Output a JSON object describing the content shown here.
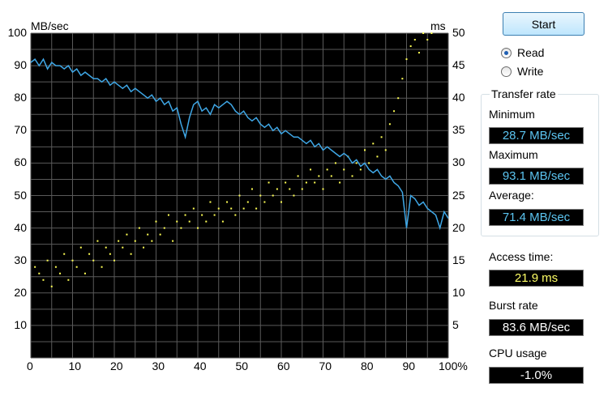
{
  "chart": {
    "y_unit_left": "MB/sec",
    "y_unit_right": "ms",
    "left_ticks": [
      "100",
      "90",
      "80",
      "70",
      "60",
      "50",
      "40",
      "30",
      "20",
      "10"
    ],
    "right_ticks": [
      "50",
      "45",
      "40",
      "35",
      "30",
      "25",
      "20",
      "15",
      "10",
      "5"
    ],
    "x_ticks": [
      "0",
      "10",
      "20",
      "30",
      "40",
      "50",
      "60",
      "70",
      "80",
      "90",
      "100%"
    ],
    "colors": {
      "background": "#000000",
      "grid": "#5a5a5a",
      "transfer_line": "#3fa7e6",
      "access_points": "#ffff55"
    }
  },
  "chart_data": {
    "type": "line",
    "x": [
      0,
      1,
      2,
      3,
      4,
      5,
      6,
      7,
      8,
      9,
      10,
      11,
      12,
      13,
      14,
      15,
      16,
      17,
      18,
      19,
      20,
      21,
      22,
      23,
      24,
      25,
      26,
      27,
      28,
      29,
      30,
      31,
      32,
      33,
      34,
      35,
      36,
      37,
      38,
      39,
      40,
      41,
      42,
      43,
      44,
      45,
      46,
      47,
      48,
      49,
      50,
      51,
      52,
      53,
      54,
      55,
      56,
      57,
      58,
      59,
      60,
      61,
      62,
      63,
      64,
      65,
      66,
      67,
      68,
      69,
      70,
      71,
      72,
      73,
      74,
      75,
      76,
      77,
      78,
      79,
      80,
      81,
      82,
      83,
      84,
      85,
      86,
      87,
      88,
      89,
      90,
      91,
      92,
      93,
      94,
      95,
      96,
      97,
      98,
      99,
      100
    ],
    "series": [
      {
        "values": [
          91,
          92,
          90,
          92,
          89,
          91,
          90,
          90,
          89,
          90,
          88,
          89,
          87,
          88,
          87,
          86,
          86,
          85,
          86,
          84,
          85,
          84,
          83,
          84,
          82,
          83,
          82,
          81,
          80,
          81,
          79,
          80,
          78,
          79,
          76,
          77,
          72,
          68,
          74,
          78,
          79,
          76,
          77,
          75,
          78,
          77,
          78,
          79,
          78,
          76,
          75,
          76,
          74,
          73,
          74,
          72,
          71,
          72,
          70,
          71,
          69,
          70,
          69,
          68,
          68,
          67,
          66,
          67,
          65,
          66,
          64,
          65,
          64,
          63,
          62,
          63,
          62,
          60,
          61,
          59,
          60,
          58,
          57,
          58,
          56,
          55,
          56,
          54,
          53,
          51,
          40,
          50,
          49,
          47,
          48,
          46,
          45,
          44,
          40,
          45,
          43
        ]
      }
    ],
    "access_time_ms": [
      [
        1,
        14
      ],
      [
        2,
        13
      ],
      [
        3,
        12
      ],
      [
        4,
        15
      ],
      [
        5,
        11
      ],
      [
        6,
        14
      ],
      [
        7,
        13
      ],
      [
        8,
        16
      ],
      [
        9,
        12
      ],
      [
        10,
        15
      ],
      [
        11,
        14
      ],
      [
        12,
        17
      ],
      [
        13,
        13
      ],
      [
        14,
        16
      ],
      [
        15,
        15
      ],
      [
        16,
        18
      ],
      [
        17,
        14
      ],
      [
        18,
        17
      ],
      [
        19,
        16
      ],
      [
        20,
        15
      ],
      [
        21,
        18
      ],
      [
        22,
        17
      ],
      [
        23,
        19
      ],
      [
        24,
        16
      ],
      [
        25,
        18
      ],
      [
        26,
        20
      ],
      [
        27,
        17
      ],
      [
        28,
        19
      ],
      [
        29,
        18
      ],
      [
        30,
        21
      ],
      [
        31,
        19
      ],
      [
        32,
        20
      ],
      [
        33,
        22
      ],
      [
        34,
        18
      ],
      [
        35,
        21
      ],
      [
        36,
        20
      ],
      [
        37,
        22
      ],
      [
        38,
        21
      ],
      [
        39,
        23
      ],
      [
        40,
        20
      ],
      [
        41,
        22
      ],
      [
        42,
        21
      ],
      [
        43,
        24
      ],
      [
        44,
        22
      ],
      [
        45,
        23
      ],
      [
        46,
        21
      ],
      [
        47,
        24
      ],
      [
        48,
        23
      ],
      [
        49,
        22
      ],
      [
        50,
        25
      ],
      [
        51,
        23
      ],
      [
        52,
        24
      ],
      [
        53,
        26
      ],
      [
        54,
        23
      ],
      [
        55,
        25
      ],
      [
        56,
        24
      ],
      [
        57,
        27
      ],
      [
        58,
        25
      ],
      [
        59,
        26
      ],
      [
        60,
        24
      ],
      [
        61,
        27
      ],
      [
        62,
        26
      ],
      [
        63,
        25
      ],
      [
        64,
        28
      ],
      [
        65,
        26
      ],
      [
        66,
        27
      ],
      [
        67,
        29
      ],
      [
        68,
        27
      ],
      [
        69,
        28
      ],
      [
        70,
        26
      ],
      [
        71,
        29
      ],
      [
        72,
        28
      ],
      [
        73,
        30
      ],
      [
        74,
        27
      ],
      [
        75,
        29
      ],
      [
        76,
        31
      ],
      [
        77,
        28
      ],
      [
        78,
        30
      ],
      [
        79,
        29
      ],
      [
        80,
        32
      ],
      [
        81,
        30
      ],
      [
        82,
        33
      ],
      [
        83,
        31
      ],
      [
        84,
        34
      ],
      [
        85,
        32
      ],
      [
        86,
        36
      ],
      [
        87,
        38
      ],
      [
        88,
        40
      ],
      [
        89,
        43
      ],
      [
        90,
        46
      ],
      [
        91,
        48
      ],
      [
        92,
        49
      ],
      [
        93,
        47
      ],
      [
        94,
        50
      ],
      [
        95,
        49
      ],
      [
        96,
        50
      ]
    ],
    "xlim": [
      0,
      100
    ],
    "ylim": [
      0,
      100
    ],
    "ylim_right": [
      0,
      50
    ],
    "grid": true
  },
  "controls": {
    "start_label": "Start",
    "read_label": "Read",
    "write_label": "Write",
    "mode": "read"
  },
  "transfer_rate": {
    "title": "Transfer rate",
    "minimum_label": "Minimum",
    "minimum_value": "28.7 MB/sec",
    "maximum_label": "Maximum",
    "maximum_value": "93.1 MB/sec",
    "average_label": "Average:",
    "average_value": "71.4 MB/sec"
  },
  "stats": {
    "access_time_label": "Access time:",
    "access_time_value": "21.9",
    "access_time_unit": "ms",
    "burst_rate_label": "Burst rate",
    "burst_rate_value": "83.6 MB/sec",
    "cpu_usage_label": "CPU usage",
    "cpu_usage_value": "-1.0%"
  }
}
